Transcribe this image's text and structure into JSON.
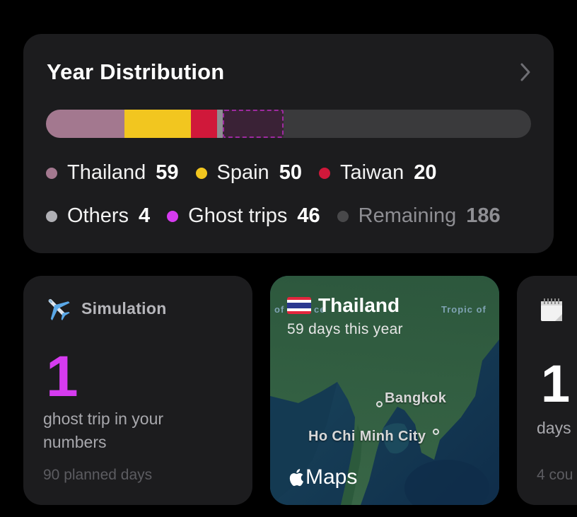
{
  "year_distribution": {
    "title": "Year Distribution",
    "bar": [
      {
        "name": "Thailand",
        "value": 59,
        "color": "#a3788f"
      },
      {
        "name": "Spain",
        "value": 50,
        "color": "#f2c61f"
      },
      {
        "name": "Taiwan",
        "value": 20,
        "color": "#d0183a"
      },
      {
        "name": "Others",
        "value": 4,
        "color": "#8e8e93"
      },
      {
        "name": "Ghost trips",
        "value": 46,
        "color": "#d63bf0",
        "style": "dashed"
      },
      {
        "name": "Remaining",
        "value": 186,
        "color": "#3a3a3c"
      }
    ],
    "legend": [
      {
        "label": "Thailand",
        "value": "59",
        "color": "#a3788f"
      },
      {
        "label": "Spain",
        "value": "50",
        "color": "#f2c61f"
      },
      {
        "label": "Taiwan",
        "value": "20",
        "color": "#d0183a"
      },
      {
        "label": "Others",
        "value": "4",
        "color": "#b0b0b5"
      },
      {
        "label": "Ghost trips",
        "value": "46",
        "color": "#d63bf0"
      },
      {
        "label": "Remaining",
        "value": "186",
        "color": "#48484a"
      }
    ]
  },
  "simulation_card": {
    "icon": "airplane-icon",
    "title": "Simulation",
    "count": "1",
    "description": "ghost trip in your numbers",
    "footer": "90 planned days"
  },
  "map_card": {
    "flag": "thailand-flag-icon",
    "title": "Thailand",
    "subtitle": "59 days this year",
    "cities": [
      "Bangkok",
      "Ho Chi Minh City"
    ],
    "map_labels": [
      "of",
      "ce",
      "Tropic of"
    ],
    "brand": "Maps"
  },
  "calendar_card": {
    "icon": "calendar-icon",
    "count": "1",
    "description": "days",
    "footer": "4 cou"
  }
}
